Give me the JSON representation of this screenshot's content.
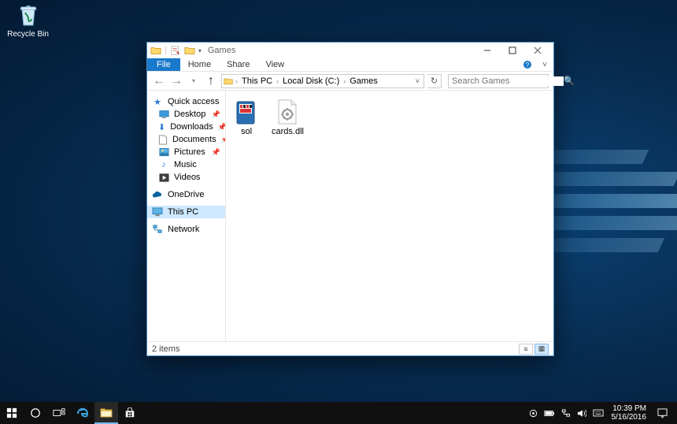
{
  "desktop": {
    "recycle_bin": "Recycle Bin"
  },
  "window": {
    "title": "Games",
    "ribbon": {
      "file": "File",
      "tabs": [
        "Home",
        "Share",
        "View"
      ]
    },
    "breadcrumb": [
      "This PC",
      "Local Disk (C:)",
      "Games"
    ],
    "search_placeholder": "Search Games",
    "sidebar": {
      "quick_access": "Quick access",
      "qa_items": [
        {
          "label": "Desktop",
          "pinned": true
        },
        {
          "label": "Downloads",
          "pinned": true
        },
        {
          "label": "Documents",
          "pinned": true
        },
        {
          "label": "Pictures",
          "pinned": true
        },
        {
          "label": "Music",
          "pinned": false
        },
        {
          "label": "Videos",
          "pinned": false
        }
      ],
      "onedrive": "OneDrive",
      "this_pc": "This PC",
      "network": "Network"
    },
    "files": [
      {
        "name": "sol",
        "kind": "exe"
      },
      {
        "name": "cards.dll",
        "kind": "dll"
      }
    ],
    "status": "2 items"
  },
  "taskbar": {
    "time": "10:39 PM",
    "date": "5/16/2016"
  }
}
